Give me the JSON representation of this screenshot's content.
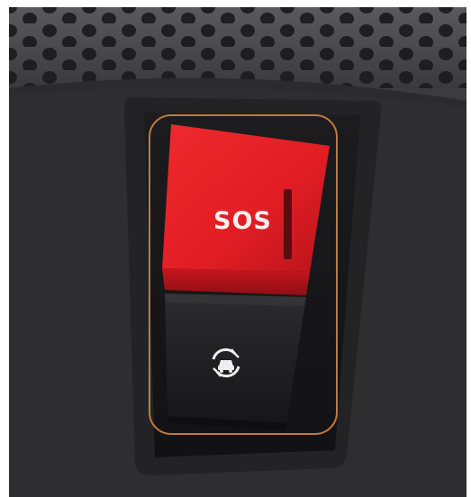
{
  "scene": {
    "description_free": true,
    "sos_button": {
      "label": "SOS",
      "color": "#e41f26",
      "icon": "indicator-bar"
    },
    "assistance_button": {
      "icon": "roadside-assistance-car-icon",
      "color": "#1f1f22"
    },
    "highlight_outline_color": "#c27a3a",
    "speaker_grille_color": "#3a3a3c",
    "panel_color": "#2a2a2c"
  }
}
